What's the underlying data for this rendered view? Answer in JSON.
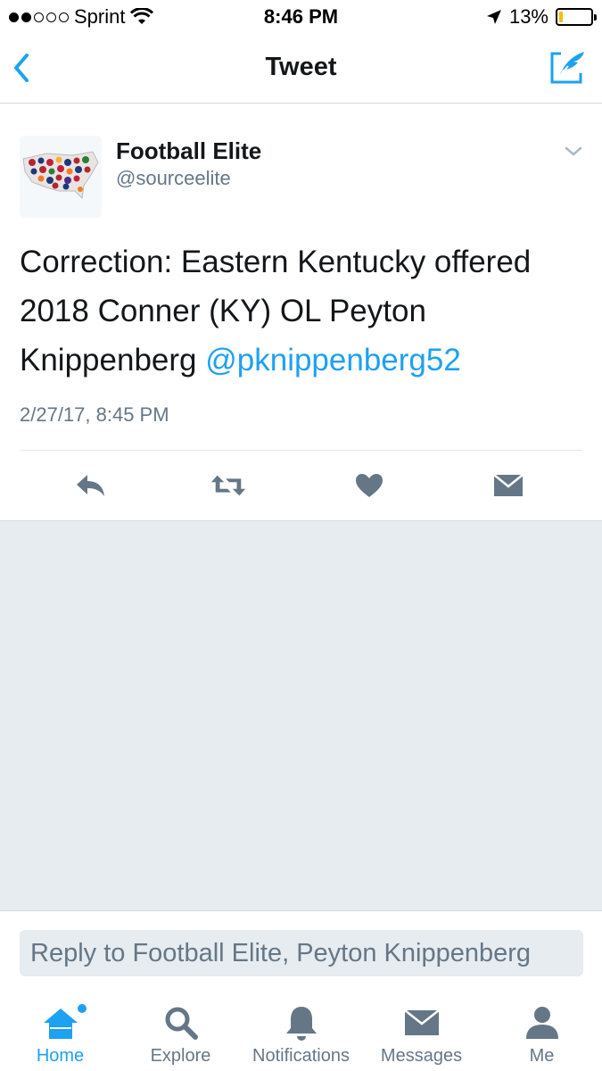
{
  "status_bar": {
    "carrier": "Sprint",
    "time": "8:46 PM",
    "battery_percent": "13%",
    "signal_bars_filled": 2,
    "signal_bars_total": 5,
    "battery_level": 0.13
  },
  "nav": {
    "title": "Tweet",
    "back_icon": "chevron-left-icon",
    "compose_icon": "compose-tweet-icon"
  },
  "tweet": {
    "author_name": "Football Elite",
    "author_handle": "@sourceelite",
    "text": "Correction: Eastern Kentucky offered 2018 Conner (KY) OL Peyton Knippenberg ",
    "mention": "@pknippenberg52",
    "timestamp": "2/27/17, 8:45 PM",
    "actions": [
      "reply-icon",
      "retweet-icon",
      "like-icon",
      "direct-message-icon"
    ]
  },
  "reply": {
    "placeholder": "Reply to Football Elite, Peyton Knippenberg"
  },
  "tabs": [
    {
      "label": "Home",
      "icon": "home-icon",
      "active": true
    },
    {
      "label": "Explore",
      "icon": "search-icon",
      "active": false
    },
    {
      "label": "Notifications",
      "icon": "bell-icon",
      "active": false
    },
    {
      "label": "Messages",
      "icon": "envelope-icon",
      "active": false
    },
    {
      "label": "Me",
      "icon": "person-icon",
      "active": false
    }
  ],
  "colors": {
    "accent": "#1da1f2",
    "text_primary": "#14171a",
    "text_secondary": "#657786",
    "background_grey": "#e6ecf0",
    "battery_low": "#f2c100"
  }
}
